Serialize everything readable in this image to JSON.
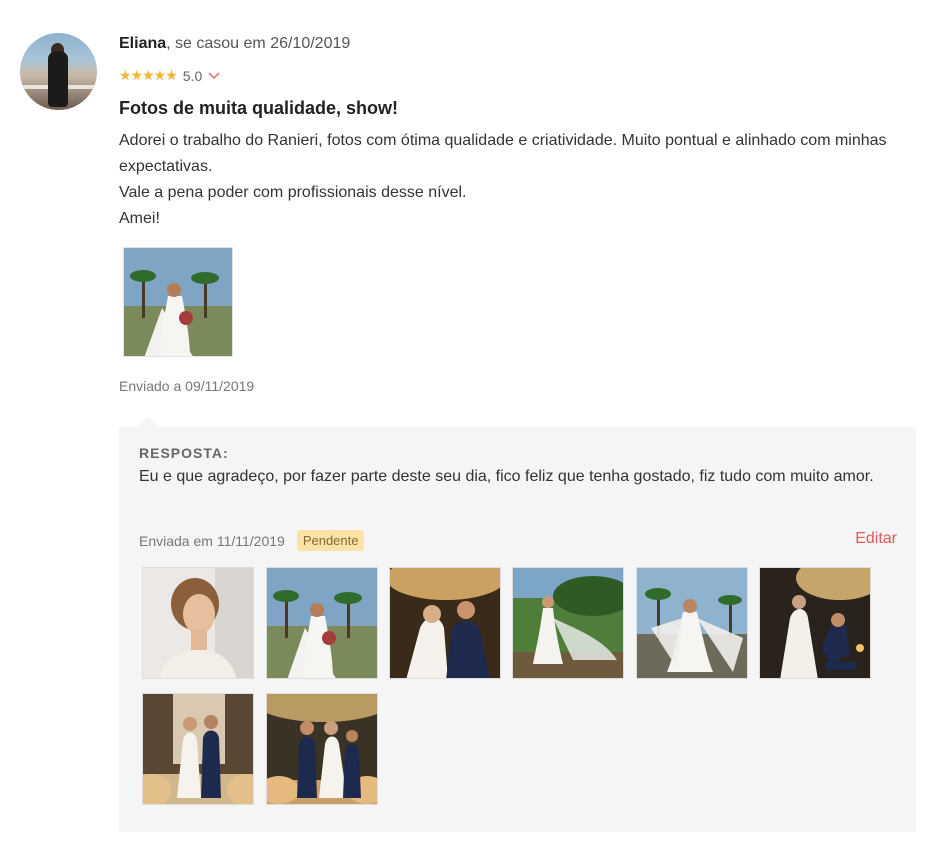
{
  "review": {
    "author": "Eliana",
    "author_suffix": ", se casou em 26/10/2019",
    "stars": "★★★★★",
    "rating": "5.0",
    "title": "Fotos de muita qualidade, show!",
    "body_lines": [
      "Adorei o trabalho do Ranieri, fotos com ótima qualidade e criatividade. Muito pontual e alinhado com minhas expectativas.",
      "Vale a pena poder com profissionais desse nível.",
      "Amei!"
    ],
    "sent": "Enviado a 09/11/2019"
  },
  "reply": {
    "label": "RESPOSTA:",
    "text": "Eu e que agradeço, por fazer parte deste seu dia, fico feliz que tenha gostado, fiz tudo com muito amor.",
    "date": "Enviada em 11/11/2019",
    "status": "Pendente",
    "edit_label": "Editar"
  },
  "colors": {
    "star": "#f2b632",
    "edit_link": "#e05858",
    "badge_bg": "#fbe2a6",
    "reply_bg": "#f5f5f5"
  },
  "icons": {
    "rating_toggle": "chevron-down-icon",
    "rating_stars": "star-icon"
  }
}
